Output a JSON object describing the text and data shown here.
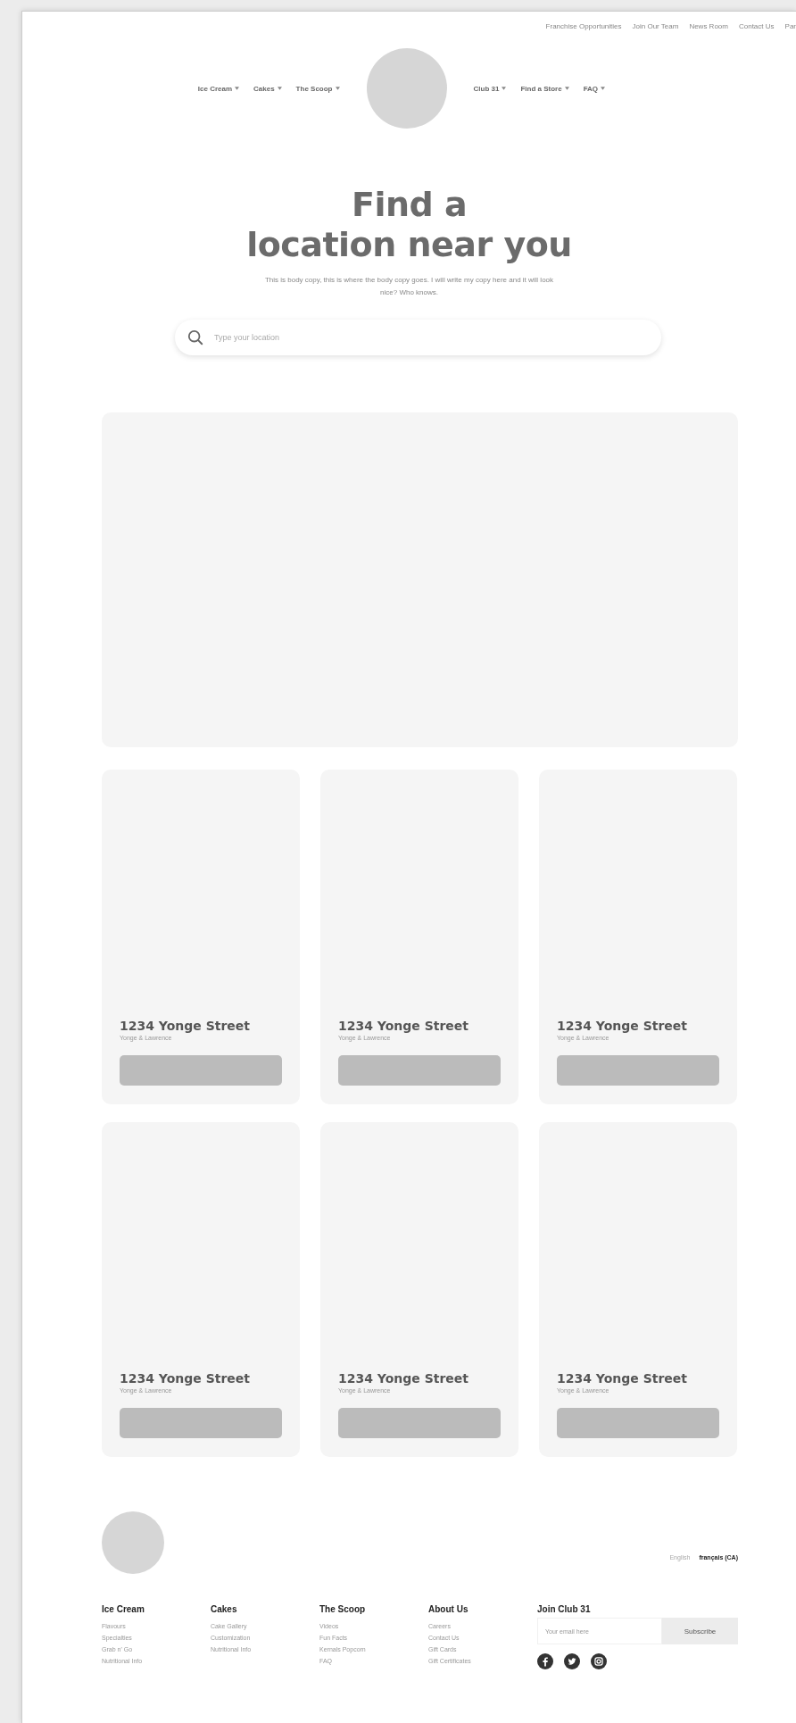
{
  "top_links": [
    "Franchise Opportunities",
    "Join Our Team",
    "News Room",
    "Contact Us",
    "Par"
  ],
  "nav_left": [
    {
      "label": "Ice Cream"
    },
    {
      "label": "Cakes"
    },
    {
      "label": "The Scoop"
    }
  ],
  "nav_right": [
    {
      "label": "Club 31"
    },
    {
      "label": "Find a Store"
    },
    {
      "label": "FAQ"
    }
  ],
  "hero": {
    "title_line_1": "Find a",
    "title_line_2": "location near you",
    "body": "This is body copy, this is where the body copy goes. I will write my copy here and it will look nice? Who knows."
  },
  "search": {
    "placeholder": "Type your location"
  },
  "stores": [
    {
      "name": "1234 Yonge Street",
      "area": "Yonge & Lawrence"
    },
    {
      "name": "1234 Yonge Street",
      "area": "Yonge & Lawrence"
    },
    {
      "name": "1234 Yonge Street",
      "area": "Yonge & Lawrence"
    },
    {
      "name": "1234 Yonge Street",
      "area": "Yonge & Lawrence"
    },
    {
      "name": "1234 Yonge Street",
      "area": "Yonge & Lawrence"
    },
    {
      "name": "1234 Yonge Street",
      "area": "Yonge & Lawrence"
    }
  ],
  "languages": [
    {
      "label": "English",
      "selected": false
    },
    {
      "label": "français (CA)",
      "selected": true
    }
  ],
  "footer_columns": [
    {
      "heading": "Ice Cream",
      "links": [
        "Flavours",
        "Specialties",
        "Grab n' Go",
        "Nutritional Info"
      ]
    },
    {
      "heading": "Cakes",
      "links": [
        "Cake Gallery",
        "Customization",
        "Nutritional Info"
      ]
    },
    {
      "heading": "The Scoop",
      "links": [
        "Videos",
        "Fun Facts",
        "Kernals Popcorn",
        "FAQ"
      ]
    },
    {
      "heading": "About Us",
      "links": [
        "Careers",
        "Contact Us",
        "Gift Cards",
        "Gift Certificates"
      ]
    }
  ],
  "newsletter": {
    "heading": "Join Club 31",
    "placeholder": "Your email here",
    "button": "Subscribe"
  },
  "social": [
    {
      "kind": "facebook"
    },
    {
      "kind": "twitter"
    },
    {
      "kind": "instagram"
    }
  ]
}
